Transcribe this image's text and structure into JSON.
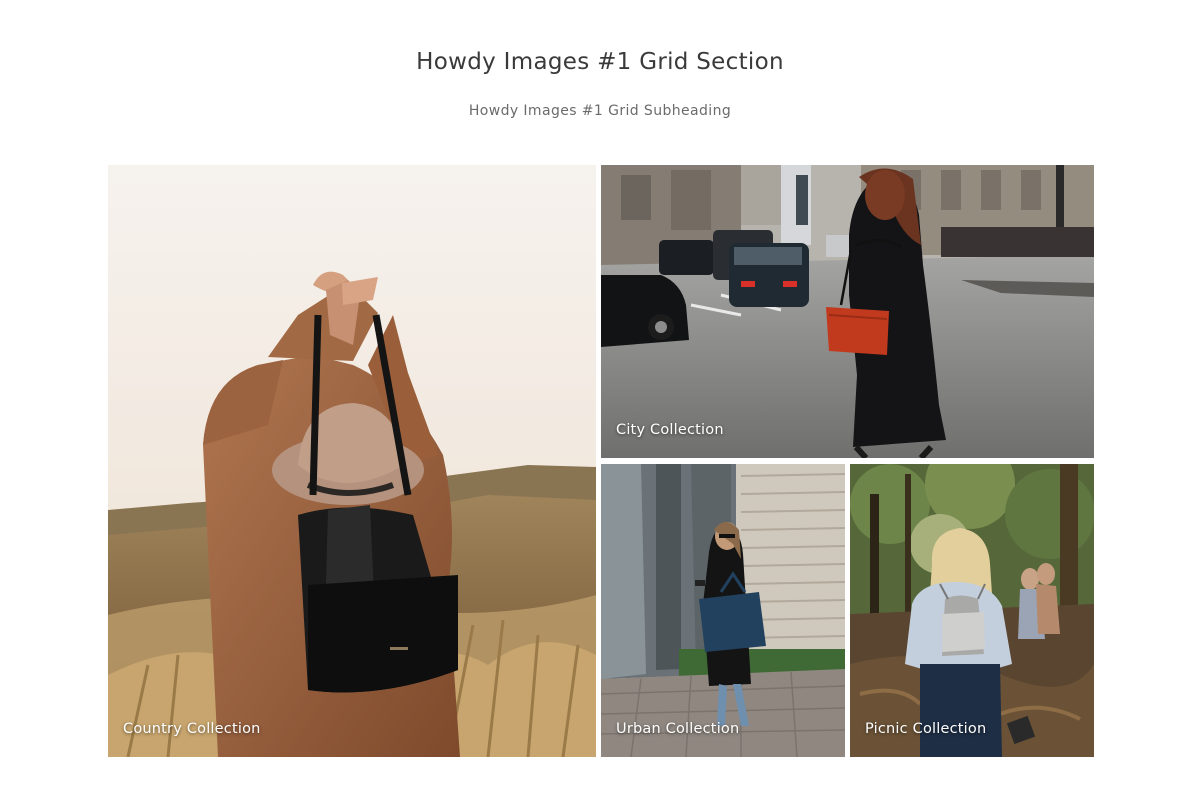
{
  "section": {
    "title": "Howdy Images #1 Grid Section",
    "subtitle": "Howdy Images #1 Grid Subheading"
  },
  "tiles": [
    {
      "caption": "Country Collection",
      "image": "woman-hat-black-bucket-bag-dunes"
    },
    {
      "caption": "City Collection",
      "image": "woman-red-bag-city-street"
    },
    {
      "caption": "Urban Collection",
      "image": "woman-blue-tote-building"
    },
    {
      "caption": "Picnic Collection",
      "image": "woman-backpack-forest"
    }
  ],
  "colors": {
    "background": "#ffffff",
    "title": "#3a3a3a",
    "subtitle": "#6b6b6b",
    "caption": "#ffffff"
  }
}
